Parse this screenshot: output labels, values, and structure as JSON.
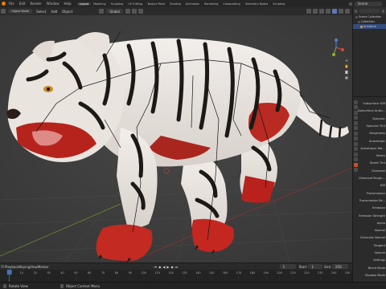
{
  "topbar": {
    "menus": [
      "File",
      "Edit",
      "Render",
      "Window",
      "Help"
    ],
    "workspaces": [
      "Layout",
      "Modeling",
      "Sculpting",
      "UV Editing",
      "Texture Paint",
      "Shading",
      "Animation",
      "Rendering",
      "Compositing",
      "Geometry Nodes",
      "Scripting"
    ],
    "active_workspace": "Layout",
    "scene_label": "Scene"
  },
  "viewport_header": {
    "items": [
      "Select",
      "Add",
      "Object"
    ],
    "orientation": "Global",
    "mode": "Object Mode"
  },
  "outliner": {
    "rows": [
      "Scene Collection",
      "Collection",
      "Armature"
    ]
  },
  "properties": {
    "labels": [
      "Subsurface IOR",
      "Subsurface Aniso...",
      "Specular",
      "Specular Tint",
      "Roughness",
      "Anisotropic",
      "Anisotropic Rot...",
      "Sheen",
      "Sheen Tint",
      "Clearcoat",
      "Clearcoat Rough...",
      "IOR",
      "Transmission",
      "Transmission Ro...",
      "Emission",
      "Emission Strength",
      "Alpha",
      "Normal",
      "Clearcoat Normal",
      "Tangent",
      "Volume",
      "Settings",
      "Blend Mode",
      "Shadow Mode"
    ]
  },
  "timeline": {
    "controls": [
      "Playback",
      "Keying",
      "View",
      "Marker"
    ],
    "current_frame": "1",
    "start_label": "Start",
    "start": "1",
    "end_label": "End",
    "end": "250",
    "ticks": [
      "0",
      "10",
      "20",
      "30",
      "40",
      "50",
      "60",
      "70",
      "80",
      "90",
      "100",
      "110",
      "120",
      "130",
      "140",
      "150",
      "160",
      "170",
      "180",
      "190",
      "200",
      "210",
      "220",
      "230",
      "240",
      "250"
    ]
  },
  "status_bar": {
    "left": "Rotate View",
    "middle": "Object Context Menu"
  },
  "colors": {
    "accent": "#4772b3",
    "playhead": "#4772b3",
    "active_tab": "#c84f2c"
  }
}
